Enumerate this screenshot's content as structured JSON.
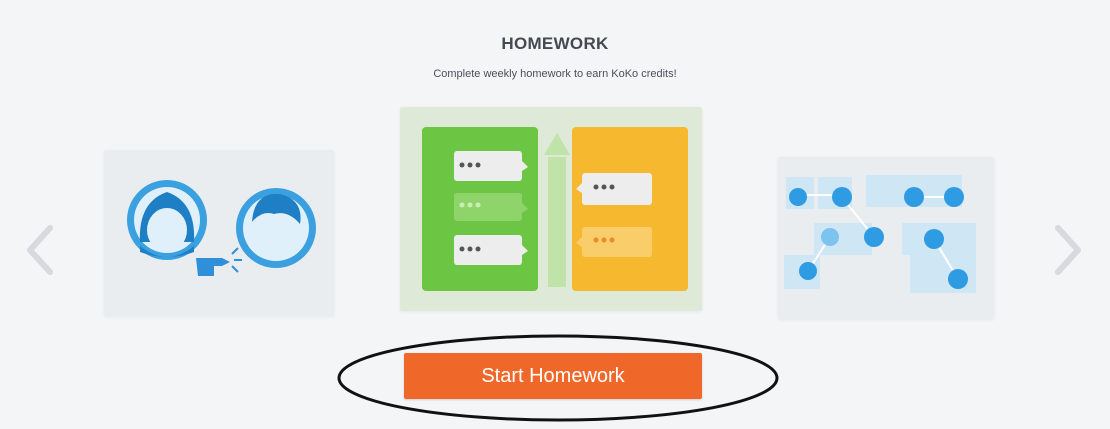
{
  "header": {
    "title": "HOMEWORK",
    "subtitle": "Complete weekly homework to earn KoKo credits!"
  },
  "carousel": {
    "prev_icon": "chevron-left-icon",
    "next_icon": "chevron-right-icon",
    "slides": [
      {
        "name": "collaboration-illustration"
      },
      {
        "name": "homework-chat-illustration"
      },
      {
        "name": "connections-illustration"
      }
    ]
  },
  "actions": {
    "start_label": "Start Homework"
  },
  "colors": {
    "accent": "#f0672a",
    "green": "#6cc644",
    "yellow": "#f5b82e",
    "blue": "#2f9be3",
    "annotation": "#111111"
  }
}
